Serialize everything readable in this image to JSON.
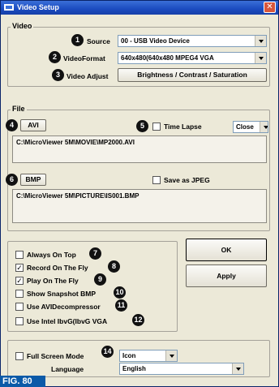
{
  "window": {
    "title": "Video Setup",
    "close_glyph": "✕",
    "title_icon": "video-icon"
  },
  "video": {
    "group_label": "Video",
    "source_label": "Source",
    "source_value": "00 - USB Video Device",
    "format_label": "VideoFormat",
    "format_value": "640x480(640x480 MPEG4 VGA",
    "adjust_label": "Video Adjust",
    "adjust_button": "Brightness / Contrast / Saturation"
  },
  "file": {
    "group_label": "File",
    "avi_button": "AVI",
    "time_lapse_label": "Time Lapse",
    "time_lapse_checked": false,
    "time_lapse_option": "Close",
    "avi_path": "C:\\MicroViewer 5M\\MOVIE\\MP2000.AVI",
    "bmp_button": "BMP",
    "save_jpeg_label": "Save as JPEG",
    "save_jpeg_checked": false,
    "bmp_path": "C:\\MicroViewer 5M\\PICTURE\\IS001.BMP"
  },
  "options": [
    {
      "label": "Always On Top",
      "checked": false,
      "badge": "7"
    },
    {
      "label": "Record On The Fly",
      "checked": true,
      "badge": "8"
    },
    {
      "label": "Play On The Fly",
      "checked": true,
      "badge": "9"
    },
    {
      "label": "Show Snapshot BMP",
      "checked": false,
      "badge": "10"
    },
    {
      "label": "Use AVIDecompressor",
      "checked": false,
      "badge": "11"
    },
    {
      "label": "Use Intel IbvG(IbvG VGA",
      "checked": false,
      "badge": "12"
    }
  ],
  "buttons": {
    "ok": "OK",
    "apply": "Apply"
  },
  "fullscreen": {
    "label": "Full Screen Mode",
    "checked": false,
    "mode_value": "Icon",
    "language_label": "Language",
    "language_value": "English"
  },
  "badges": {
    "source": "1",
    "format": "2",
    "adjust": "3",
    "avi": "4",
    "time_lapse": "5",
    "bmp": "6",
    "fullscreen": "14"
  },
  "check_glyph": "✓",
  "figure_label": "FIG. 80"
}
